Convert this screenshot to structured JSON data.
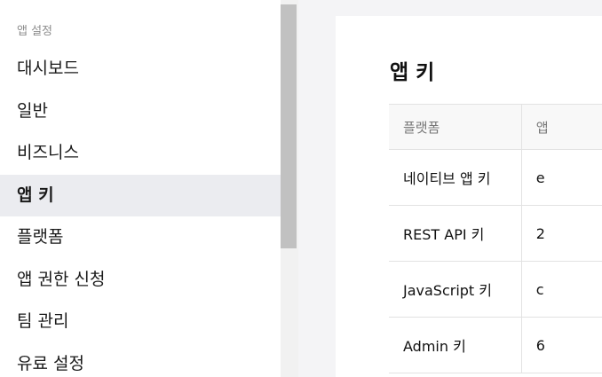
{
  "sidebar": {
    "section_title": "앱 설정",
    "items": [
      {
        "label": "대시보드"
      },
      {
        "label": "일반"
      },
      {
        "label": "비즈니스"
      },
      {
        "label": "앱 키"
      },
      {
        "label": "플랫폼"
      },
      {
        "label": "앱 권한 신청"
      },
      {
        "label": "팀 관리"
      },
      {
        "label": "유료 설정"
      }
    ],
    "active_index": 3
  },
  "main": {
    "title": "앱 키",
    "table": {
      "headers": [
        "플랫폼",
        "앱"
      ],
      "rows": [
        {
          "platform": "네이티브 앱 키",
          "key": "e"
        },
        {
          "platform": "REST API 키",
          "key": "2"
        },
        {
          "platform": "JavaScript 키",
          "key": "c"
        },
        {
          "platform": "Admin 키",
          "key": "6"
        }
      ]
    }
  },
  "colors": {
    "active_item_bg": "#ebecf0",
    "page_bg": "#f4f4f6",
    "scroll_thumb": "#c1c1c1"
  }
}
